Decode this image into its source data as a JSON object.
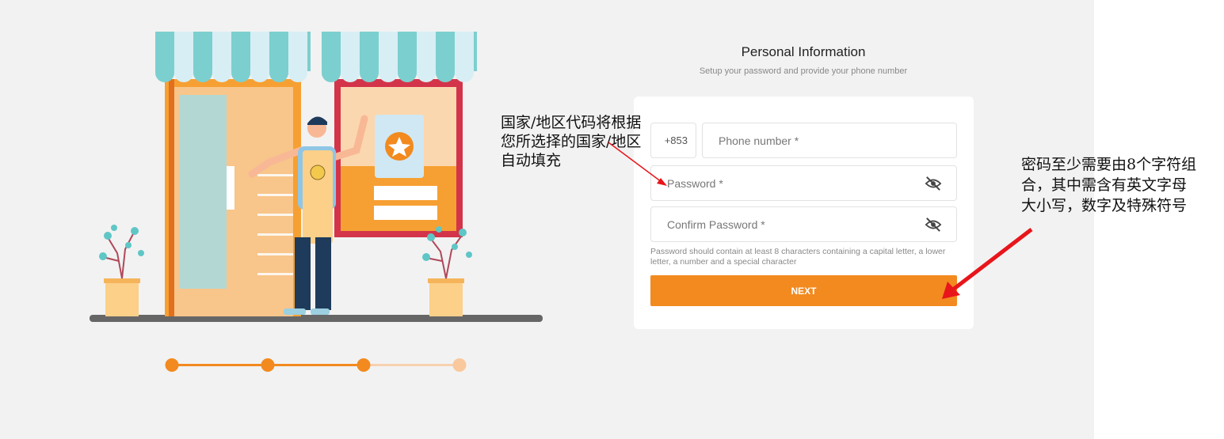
{
  "header": {
    "title": "Personal Information",
    "subtitle": "Setup your password and provide your phone number"
  },
  "form": {
    "country_code": "+853",
    "phone_placeholder": "Phone number *",
    "password_placeholder": "Password *",
    "confirm_password_placeholder": "Confirm Password *",
    "password_hint": "Password should contain at least 8 characters containing a capital letter, a lower letter, a number and a special character",
    "next_label": "NEXT"
  },
  "stepper": {
    "total_steps": 4,
    "current_step": 3
  },
  "annotations": {
    "country_code_note": "国家/地区代码将根据\n您所选择的国家/地区\n自动填充",
    "password_note": "密码至少需要由8个字符组\n合，其中需含有英文字母\n大小写，数字及特殊符号"
  },
  "icons": {
    "password_visibility": "eye-off-icon",
    "confirm_visibility": "eye-off-icon"
  },
  "colors": {
    "accent": "#f28a1f",
    "annotation_arrow": "#e8151b",
    "background": "#f2f2f2"
  }
}
